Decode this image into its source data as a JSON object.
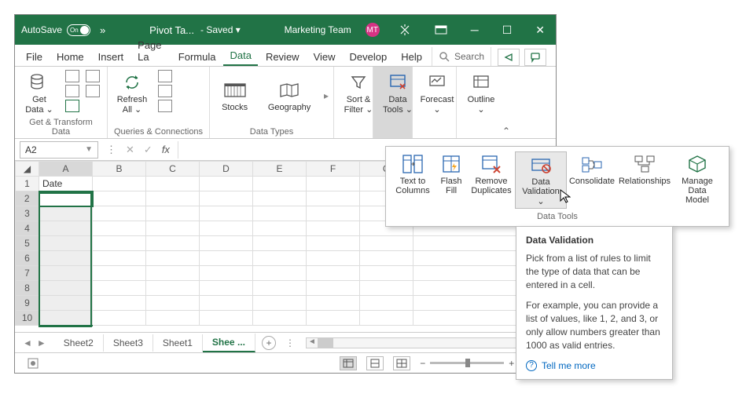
{
  "titlebar": {
    "autosave_label": "AutoSave",
    "autosave_state": "On",
    "chevrons": "»",
    "doc_title": "Pivot Ta...",
    "saved_label": "- Saved ▾",
    "team": "Marketing Team",
    "avatar": "MT"
  },
  "menutabs": [
    "File",
    "Home",
    "Insert",
    "Page La",
    "Formula",
    "Data",
    "Review",
    "View",
    "Develop",
    "Help"
  ],
  "active_tab": "Data",
  "search_placeholder": "Search",
  "ribbon": {
    "get_data": "Get\nData ⌄",
    "group1_label": "Get & Transform Data",
    "refresh": "Refresh\nAll ⌄",
    "group2_label": "Queries & Connections",
    "stocks": "Stocks",
    "geography": "Geography",
    "group3_label": "Data Types",
    "sortfilter": "Sort &\nFilter ⌄",
    "datatools": "Data\nTools ⌄",
    "forecast": "Forecast\n⌄",
    "outline": "Outline\n⌄"
  },
  "namebox": "A2",
  "grid": {
    "cols": [
      "A",
      "B",
      "C",
      "D",
      "E",
      "F",
      "G"
    ],
    "rows": [
      1,
      2,
      3,
      4,
      5,
      6,
      7,
      8,
      9,
      10
    ],
    "a1": "Date"
  },
  "sheets": [
    "Sheet2",
    "Sheet3",
    "Sheet1",
    "Shee ..."
  ],
  "active_sheet": 3,
  "zoom": "100%",
  "gallery": {
    "items": [
      {
        "label": "Text to\nColumns"
      },
      {
        "label": "Flash\nFill"
      },
      {
        "label": "Remove\nDuplicates"
      },
      {
        "label": "Data\nValidation ⌄"
      },
      {
        "label": "Consolidate"
      },
      {
        "label": "Relationships"
      },
      {
        "label": "Manage\nData Model"
      }
    ],
    "group_label": "Data Tools"
  },
  "tooltip": {
    "title": "Data Validation",
    "p1": "Pick from a list of rules to limit the type of data that can be entered in a cell.",
    "p2": "For example, you can provide a list of values, like 1, 2, and 3, or only allow numbers greater than 1000 as valid entries.",
    "tellmore": "Tell me more"
  }
}
